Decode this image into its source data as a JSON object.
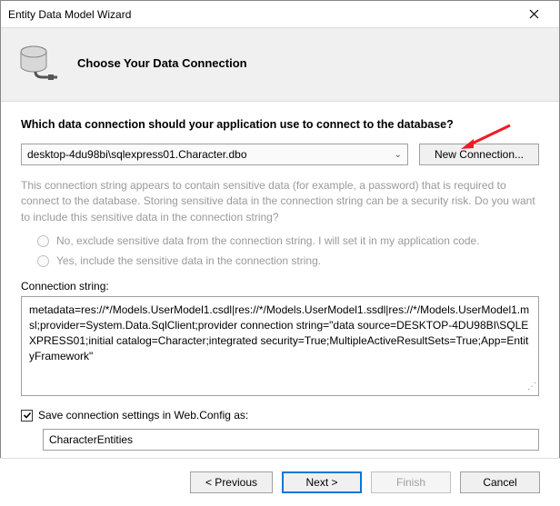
{
  "window": {
    "title": "Entity Data Model Wizard"
  },
  "header": {
    "title": "Choose Your Data Connection"
  },
  "question": "Which data connection should your application use to connect to the database?",
  "connection": {
    "selected": "desktop-4du98bi\\sqlexpress01.Character.dbo",
    "new_button": "New Connection..."
  },
  "sensitive_info": "This connection string appears to contain sensitive data (for example, a password) that is required to connect to the database. Storing sensitive data in the connection string can be a security risk. Do you want to include this sensitive data in the connection string?",
  "radio": {
    "exclude": "No, exclude sensitive data from the connection string. I will set it in my application code.",
    "include": "Yes, include the sensitive data in the connection string."
  },
  "conn_string": {
    "label": "Connection string:",
    "value": "metadata=res://*/Models.UserModel1.csdl|res://*/Models.UserModel1.ssdl|res://*/Models.UserModel1.msl;provider=System.Data.SqlClient;provider connection string=\"data source=DESKTOP-4DU98BI\\SQLEXPRESS01;initial catalog=Character;integrated security=True;MultipleActiveResultSets=True;App=EntityFramework\""
  },
  "save_settings": {
    "label": "Save connection settings in Web.Config as:",
    "value": "CharacterEntities"
  },
  "footer": {
    "previous": "< Previous",
    "next": "Next >",
    "finish": "Finish",
    "cancel": "Cancel"
  },
  "colors": {
    "arrow": "#ed1c24",
    "primary": "#0078d7"
  }
}
